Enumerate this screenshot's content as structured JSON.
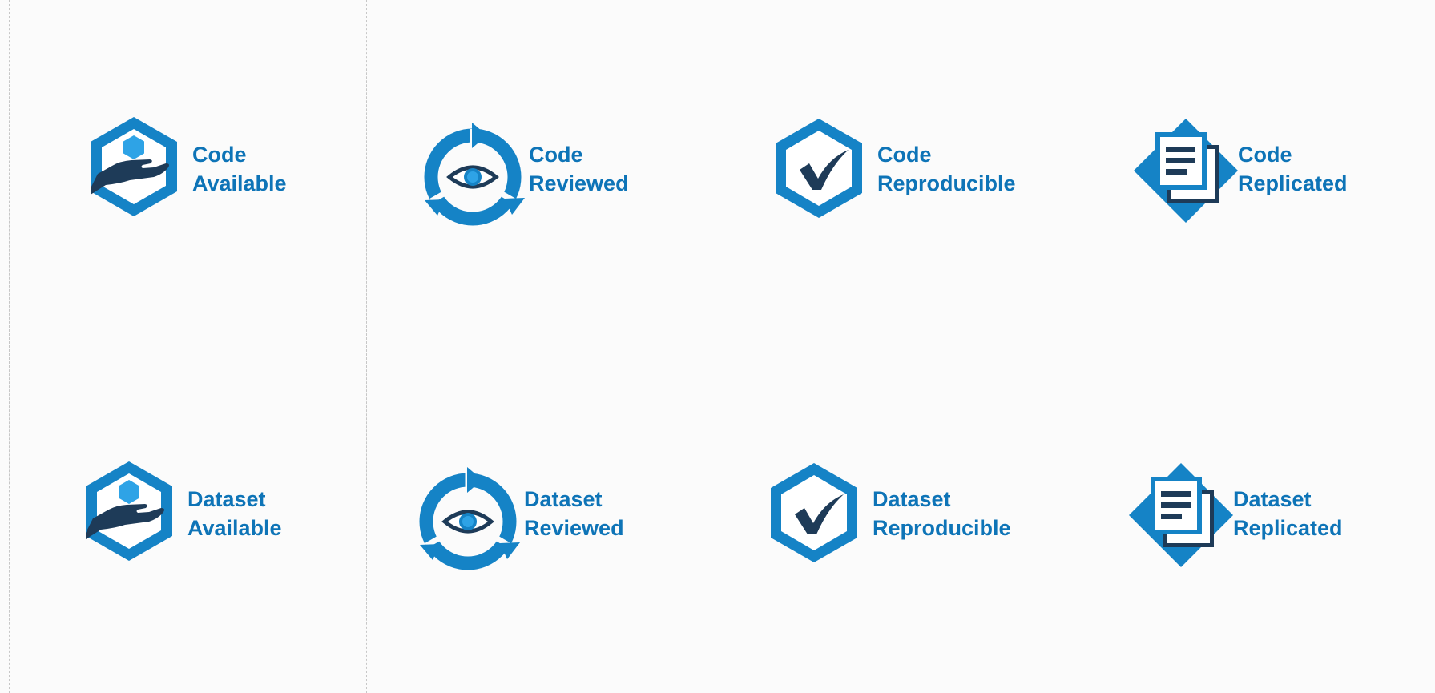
{
  "colors": {
    "primary": "#1583c6",
    "accent": "#2ea3e6",
    "dark": "#1e3b58",
    "label": "#0e74b7",
    "background": "#fbfbfb",
    "grid": "#c7c7c7"
  },
  "badges": [
    {
      "icon": "hand-hexagon-icon",
      "line1": "Code",
      "line2": "Available"
    },
    {
      "icon": "eye-cycle-icon",
      "line1": "Code",
      "line2": "Reviewed"
    },
    {
      "icon": "checkmark-hexagon-icon",
      "line1": "Code",
      "line2": "Reproducible"
    },
    {
      "icon": "documents-diamond-icon",
      "line1": "Code",
      "line2": "Replicated"
    },
    {
      "icon": "hand-hexagon-icon",
      "line1": "Dataset",
      "line2": "Available"
    },
    {
      "icon": "eye-cycle-icon",
      "line1": "Dataset",
      "line2": "Reviewed"
    },
    {
      "icon": "checkmark-hexagon-icon",
      "line1": "Dataset",
      "line2": "Reproducible"
    },
    {
      "icon": "documents-diamond-icon",
      "line1": "Dataset",
      "line2": "Replicated"
    }
  ]
}
